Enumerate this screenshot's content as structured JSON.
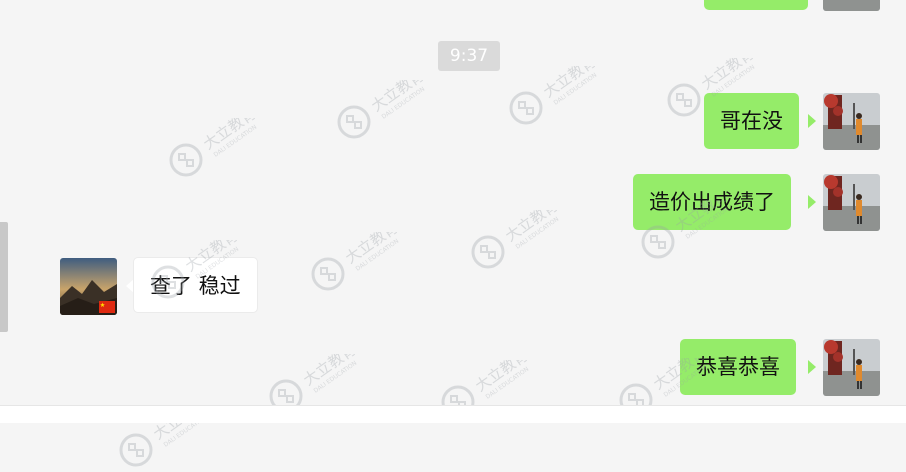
{
  "conversation": {
    "timestamp": "9:37",
    "messages": [
      {
        "sender": "me",
        "text": "哥在没"
      },
      {
        "sender": "me",
        "text": "造价出成绩了"
      },
      {
        "sender": "other",
        "text": "查了 稳过"
      },
      {
        "sender": "me",
        "text": "恭喜恭喜"
      }
    ]
  },
  "watermark": {
    "name": "大立教育",
    "subtitle": "DALI EDUCATION",
    "icon": "dali-logo-icon"
  },
  "colors": {
    "background": "#f5f5f5",
    "my_bubble": "#95ec69",
    "their_bubble": "#ffffff",
    "timestamp_bg": "#dadada"
  }
}
